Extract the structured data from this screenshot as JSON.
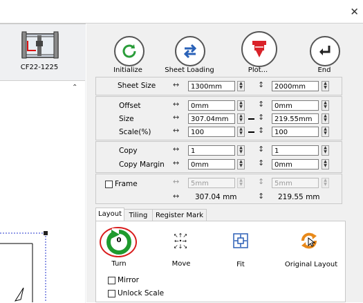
{
  "window": {
    "close_icon": "close-icon"
  },
  "device": {
    "name": "CF22-1225"
  },
  "toolbar": {
    "initialize": "Initialize",
    "sheet_loading": "Sheet Loading",
    "plot": "Plot...",
    "end": "End"
  },
  "settings": {
    "sheet_size_label": "Sheet Size",
    "sheet_width": "1300mm",
    "sheet_height": "2000mm",
    "offset_label": "Offset",
    "offset_x": "0mm",
    "offset_y": "0mm",
    "size_label": "Size",
    "size_w": "307.04mm",
    "size_h": "219.55mm",
    "scale_label": "Scale(%)",
    "scale_x": "100",
    "scale_y": "100",
    "copy_label": "Copy",
    "copy_x": "1",
    "copy_y": "1",
    "copy_margin_label": "Copy Margin",
    "copy_margin_x": "0mm",
    "copy_margin_y": "0mm",
    "frame_label": "Frame",
    "frame_x": "5mm",
    "frame_y": "5mm",
    "total_w": "307.04 mm",
    "total_h": "219.55 mm"
  },
  "tabs": {
    "layout": "Layout",
    "tiling": "Tiling",
    "register_mark": "Register Mark"
  },
  "layout_panel": {
    "turn_value": "0",
    "turn": "Turn",
    "move": "Move",
    "fit": "Fit",
    "original_layout": "Original Layout",
    "mirror": "Mirror",
    "unlock_scale": "Unlock Scale"
  }
}
